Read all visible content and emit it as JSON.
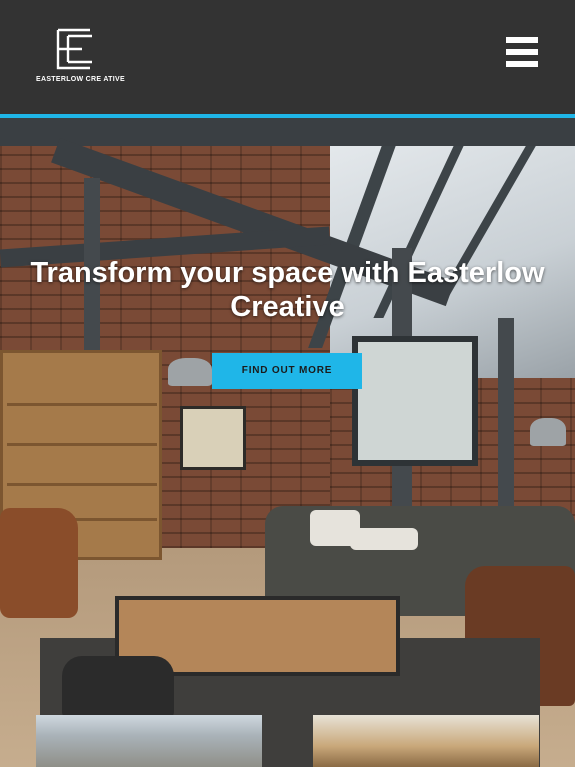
{
  "header": {
    "brand_name": "EASTERLOW CRE ATIVE",
    "logo_icon": "ec-monogram-icon",
    "menu_icon": "hamburger-menu-icon"
  },
  "hero": {
    "title": "Transform your space with Easterlow Creative",
    "cta_label": "FIND OUT MORE"
  },
  "colors": {
    "header_bg": "#333333",
    "accent": "#1fb6e8",
    "title_text": "#ffffff"
  }
}
